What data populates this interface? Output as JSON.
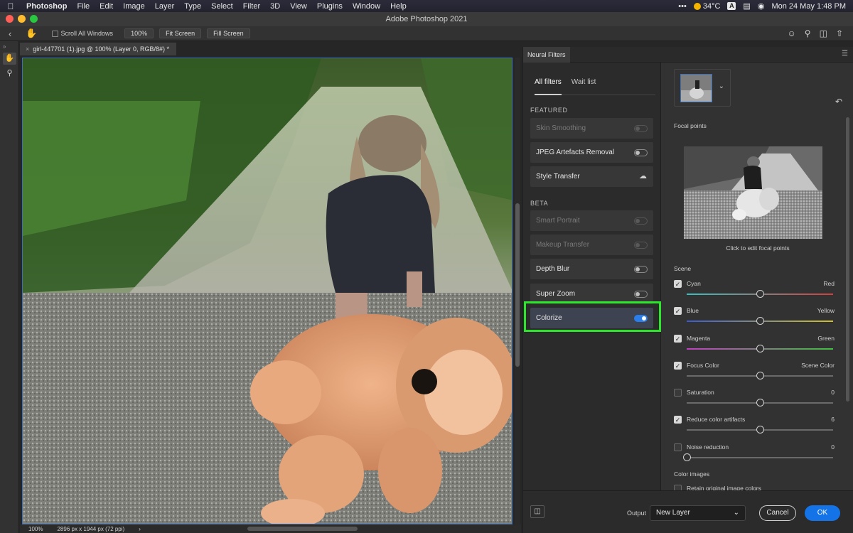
{
  "menubar": {
    "items": [
      "Photoshop",
      "File",
      "Edit",
      "Image",
      "Layer",
      "Type",
      "Select",
      "Filter",
      "3D",
      "View",
      "Plugins",
      "Window",
      "Help"
    ],
    "status": {
      "weather": "34°C",
      "input_source": "A",
      "datetime": "Mon 24 May  1:48 PM"
    }
  },
  "window": {
    "title": "Adobe Photoshop 2021"
  },
  "optionsbar": {
    "scroll_all_windows": "Scroll All Windows",
    "zoom_btn": "100%",
    "fit_screen": "Fit Screen",
    "fill_screen": "Fill Screen"
  },
  "document": {
    "tab_title": "girl-447701 (1).jpg @ 100% (Layer 0, RGB/8#) *",
    "close": "×",
    "status_zoom": "100%",
    "status_info": "2896 px x 1944 px (72 ppi)"
  },
  "neural_filters": {
    "panel_tab": "Neural Filters",
    "tabs": [
      {
        "label": "All filters",
        "active": true
      },
      {
        "label": "Wait list",
        "active": false
      }
    ],
    "featured_heading": "FEATURED",
    "featured": [
      {
        "label": "Skin Smoothing",
        "state": "disabled"
      },
      {
        "label": "JPEG Artefacts Removal",
        "state": "off"
      },
      {
        "label": "Style Transfer",
        "state": "cloud"
      }
    ],
    "beta_heading": "BETA",
    "beta": [
      {
        "label": "Smart Portrait",
        "state": "disabled"
      },
      {
        "label": "Makeup Transfer",
        "state": "disabled"
      },
      {
        "label": "Depth Blur",
        "state": "off"
      },
      {
        "label": "Super Zoom",
        "state": "off"
      },
      {
        "label": "Colorize",
        "state": "on",
        "selected": true
      }
    ],
    "highlight_color": "#2ce52c",
    "settings": {
      "focal_points_label": "Focal points",
      "focal_caption": "Click to edit focal points",
      "scene_label": "Scene",
      "sliders": [
        {
          "label": "Cyan",
          "right": "Red",
          "checked": true,
          "value": 0.5,
          "gradient": [
            "#3bbfbf",
            "#d04040"
          ]
        },
        {
          "label": "Blue",
          "right": "Yellow",
          "checked": true,
          "value": 0.5,
          "gradient": [
            "#3b5bd0",
            "#d0c030"
          ]
        },
        {
          "label": "Magenta",
          "right": "Green",
          "checked": true,
          "value": 0.5,
          "gradient": [
            "#c040c0",
            "#40c040"
          ]
        },
        {
          "label": "Focus Color",
          "right": "Scene Color",
          "checked": true,
          "value": 0.5,
          "gradient": null
        },
        {
          "label": "Saturation",
          "right": "0",
          "checked": false,
          "value": 0.5,
          "gradient": null
        },
        {
          "label": "Reduce color artifacts",
          "right": "6",
          "checked": true,
          "value": 0.5,
          "gradient": null
        },
        {
          "label": "Noise reduction",
          "right": "0",
          "checked": false,
          "value": 0.0,
          "gradient": null
        }
      ],
      "color_images_label": "Color images",
      "retain_label": "Retain original image colors",
      "retain_checked": false
    },
    "footer": {
      "output_label": "Output",
      "output_value": "New Layer",
      "cancel": "Cancel",
      "ok": "OK"
    }
  }
}
